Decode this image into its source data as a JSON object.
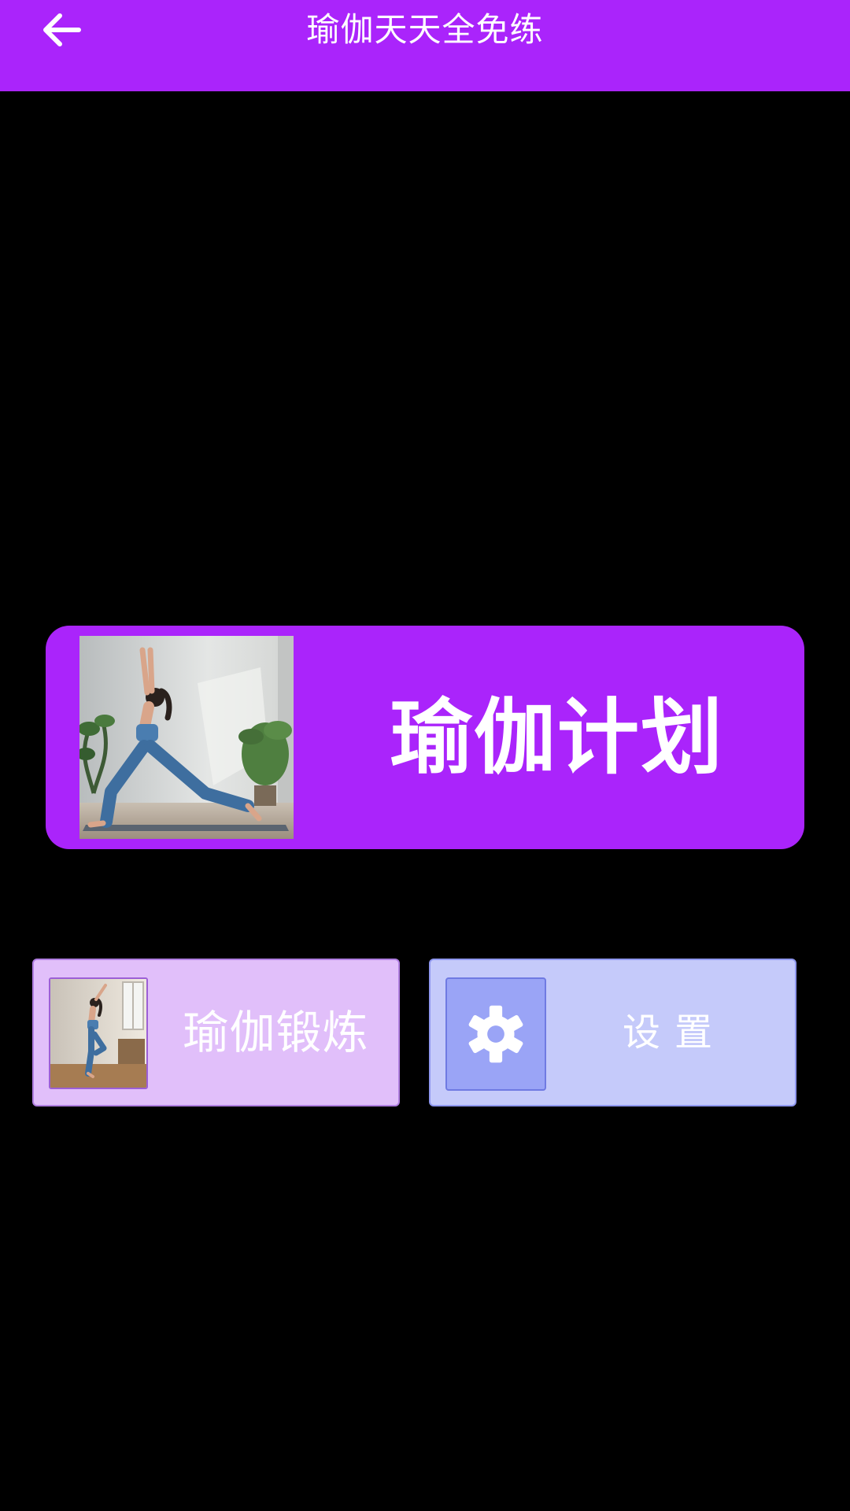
{
  "app_bar": {
    "title": "瑜伽天天全免练",
    "back_icon": "arrow-left-icon",
    "background": "#aa24fb"
  },
  "plan_card": {
    "label": "瑜伽计划",
    "image": "yoga-lunge-photo",
    "background": "#aa24fb"
  },
  "tiles": {
    "practice": {
      "label": "瑜伽锻炼",
      "image": "yoga-standing-photo",
      "background": "#e1bffa"
    },
    "settings": {
      "label": "设置",
      "icon": "gear-icon",
      "background": "#c5cafa"
    }
  },
  "colors": {
    "accent": "#aa24fb",
    "page_background": "#000000"
  }
}
